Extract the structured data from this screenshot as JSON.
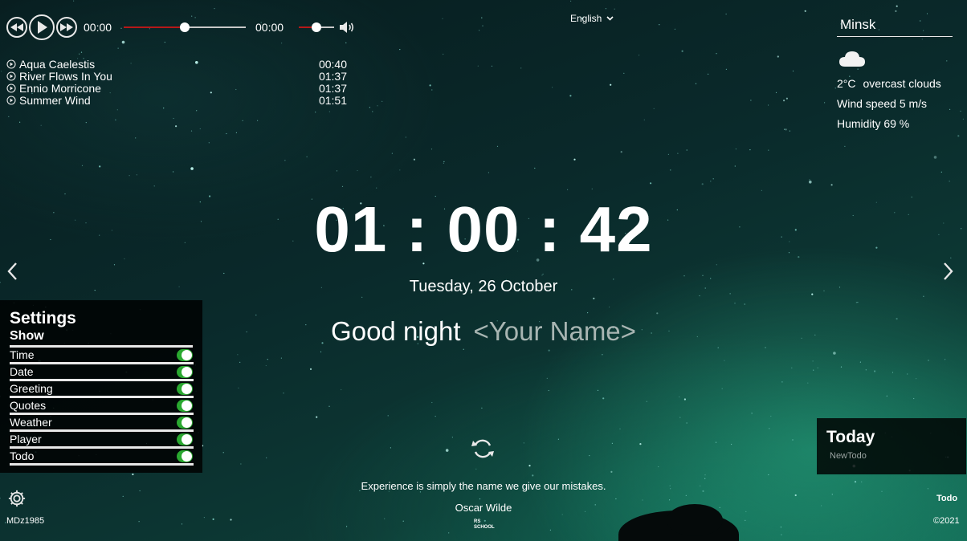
{
  "player": {
    "current_time": "00:00",
    "volume_time": "00:00",
    "progress": 0.5,
    "volume": 0.5,
    "buttons": [
      "prev-icon",
      "play-icon",
      "next-icon"
    ],
    "playlist": [
      {
        "title": "Aqua Caelestis",
        "duration": "00:40"
      },
      {
        "title": "River Flows In You",
        "duration": "01:37"
      },
      {
        "title": "Ennio Morricone",
        "duration": "01:37"
      },
      {
        "title": "Summer Wind",
        "duration": "01:51"
      }
    ]
  },
  "language": {
    "selected": "English"
  },
  "weather": {
    "city": "Minsk",
    "icon": "cloud-icon",
    "temperature": "2°C",
    "description": "overcast clouds",
    "wind": "Wind speed 5 m/s",
    "humidity": "Humidity 69 %"
  },
  "clock": {
    "time": "01 : 00 : 42"
  },
  "date": "Tuesday, 26 October",
  "greeting": {
    "text": "Good night",
    "name_placeholder": "<Your Name>"
  },
  "settings": {
    "title": "Settings",
    "section": "Show",
    "items": [
      {
        "label": "Time",
        "on": true
      },
      {
        "label": "Date",
        "on": true
      },
      {
        "label": "Greeting",
        "on": true
      },
      {
        "label": "Quotes",
        "on": true
      },
      {
        "label": "Weather",
        "on": true
      },
      {
        "label": "Player",
        "on": true
      },
      {
        "label": "Todo",
        "on": true
      }
    ]
  },
  "quote": {
    "text": "Experience is simply the name we give our mistakes.",
    "author": "Oscar Wilde"
  },
  "todo": {
    "title": "Today",
    "new_item": "NewTodo",
    "button": "Todo"
  },
  "footer": {
    "author": "MDz1985",
    "copyright": "©2021",
    "logo_text": "RS SCHOOL"
  },
  "colors": {
    "accent_toggle": "#2aa830",
    "progress_fill": "#b51818",
    "panel_bg": "#000000"
  }
}
